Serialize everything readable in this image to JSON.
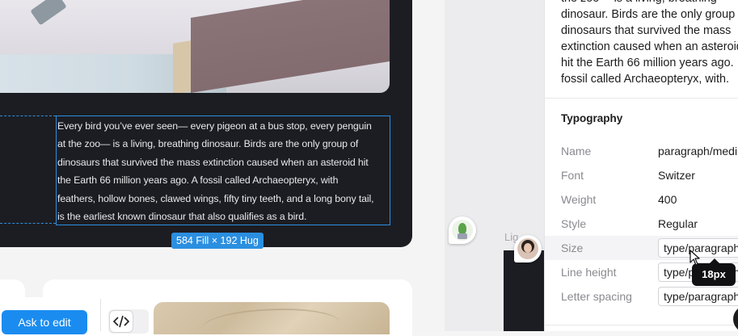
{
  "canvas": {
    "body_text_lines": [
      "Every bird you’ve ever seen— every pigeon at a bus stop, every penguin",
      "at the zoo— is a living, breathing dinosaur. Birds are the only group of",
      "dinosaurs that survived the mass extinction caused when an asteroid hit",
      "the Earth 66 million years ago. A fossil called Archaeopteryx, with",
      "feathers, hollow bones, clawed wings, fifty tiny teeth, and a long bony tail,",
      "is the earliest known dinosaur that also qualifies as a bird."
    ],
    "size_badge": "584 Fill × 192 Hug",
    "side_label": "Lig",
    "toolbar": {
      "ask_to_edit_label": "Ask to edit",
      "code_icon_glyph": "</>"
    }
  },
  "panel": {
    "preview_lines": [
      "the zoo— is a living, breathing",
      "dinosaur. Birds are the only group",
      "dinosaurs that survived the mass",
      "extinction caused when an asteroid",
      "hit the Earth 66 million years ago.",
      "fossil called Archaeopteryx, with."
    ],
    "typography": {
      "title": "Typography",
      "rows": [
        {
          "label": "Name",
          "value": "paragraph/medium"
        },
        {
          "label": "Font",
          "value": "Switzer"
        },
        {
          "label": "Weight",
          "value": "400"
        },
        {
          "label": "Style",
          "value": "Regular"
        },
        {
          "label": "Size",
          "value": "type/paragraph"
        },
        {
          "label": "Line height",
          "value": "type/paragraph"
        },
        {
          "label": "Letter spacing",
          "value": "type/paragraph"
        }
      ]
    }
  },
  "tooltip": {
    "text": "18px"
  },
  "colors": {
    "selection_blue": "#2b8fe0",
    "button_blue": "#1a8cf0",
    "dark_card": "#1c1d22"
  }
}
